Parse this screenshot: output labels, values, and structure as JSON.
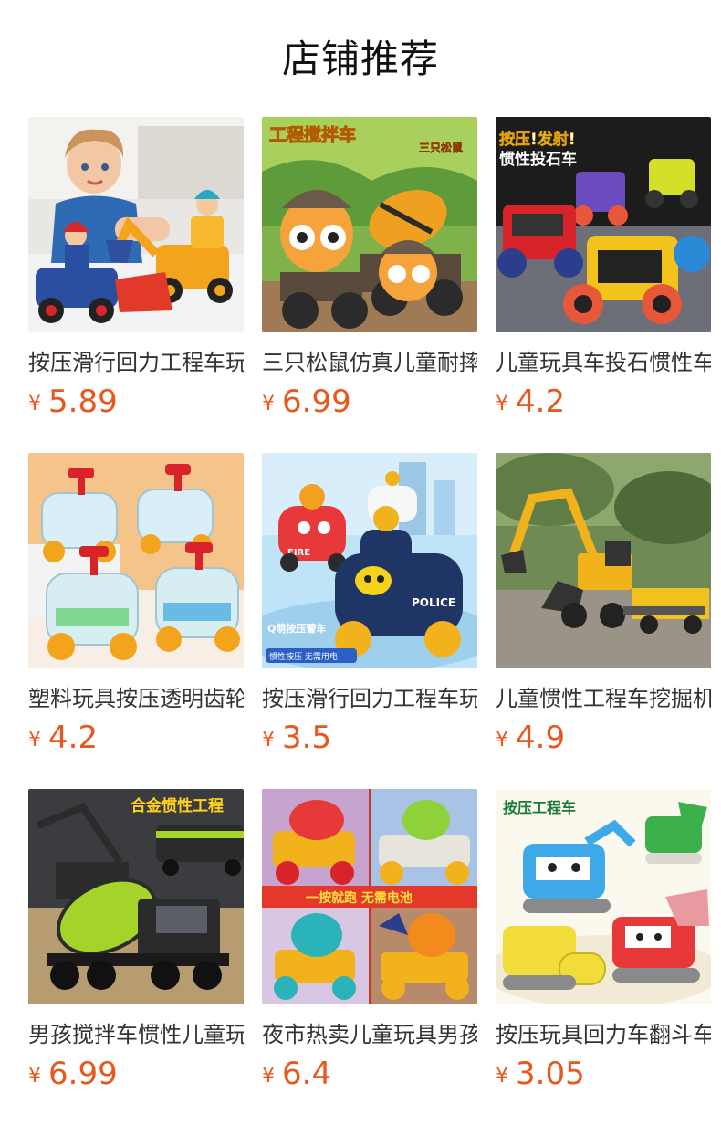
{
  "section": {
    "title": "店铺推荐"
  },
  "currency_symbol": "¥",
  "accent_color": "#e8571e",
  "products": [
    {
      "name": "按压滑行回力工程车玩具",
      "price": "5.89",
      "image_icon": "toy-excavator-with-child-image"
    },
    {
      "name": "三只松鼠仿真儿童耐摔搅拌车",
      "price": "6.99",
      "image_icon": "toy-mixer-truck-image",
      "image_text": [
        "工程搅拌车",
        "三只松鼠"
      ]
    },
    {
      "name": "儿童玩具车投石惯性车",
      "price": "4.2",
      "image_icon": "toy-catapult-car-image",
      "image_text": [
        "按压!发射!",
        "惯性投石车"
      ]
    },
    {
      "name": "塑料玩具按压透明齿轮车",
      "price": "4.2",
      "image_icon": "toy-transparent-gear-car-image"
    },
    {
      "name": "按压滑行回力工程车玩具",
      "price": "3.5",
      "image_icon": "toy-police-car-image",
      "image_text": [
        "Q萌按压警车",
        "惯性按压 无需用电",
        "POLICE",
        "FIRE"
      ]
    },
    {
      "name": "儿童惯性工程车挖掘机",
      "price": "4.9",
      "image_icon": "toy-excavator-truck-image"
    },
    {
      "name": "男孩搅拌车惯性儿童玩具",
      "price": "6.99",
      "image_icon": "toy-alloy-mixer-image",
      "image_text": [
        "合金惯性工程"
      ]
    },
    {
      "name": "夜市热卖儿童玩具男孩",
      "price": "6.4",
      "image_icon": "toy-dinosaur-cars-image",
      "image_text": [
        "一按就跑 无需电池"
      ]
    },
    {
      "name": "按压玩具回力车翻斗车",
      "price": "3.05",
      "image_icon": "toy-press-construction-image",
      "image_text": [
        "按压工程车"
      ]
    }
  ]
}
